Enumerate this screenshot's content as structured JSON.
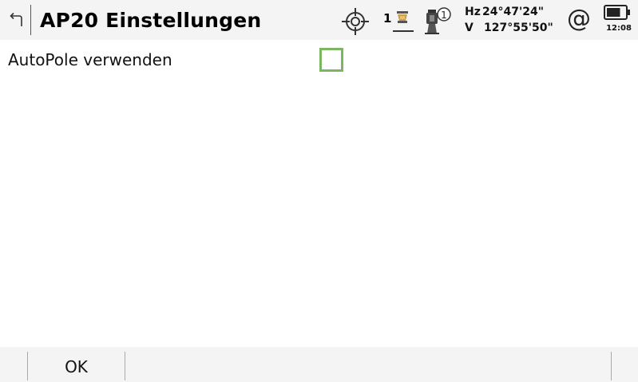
{
  "header": {
    "title": "AP20 Einstellungen",
    "back_icon": "back-arrow-icon",
    "status": {
      "target_icon": "crosshair-target-icon",
      "prism_number": "1",
      "prism_icon": "prism-pole-icon",
      "instrument_icon": "instrument-face-icon",
      "instrument_face": "1",
      "hz_label": "Hz",
      "hz_value": "24°47'24\"",
      "v_label": "V",
      "v_value": "127°55'50\"",
      "connection_symbol": "@",
      "battery_icon": "battery-icon",
      "battery_level": 0.75,
      "time": "12:08"
    }
  },
  "settings": [
    {
      "label": "AutoPole verwenden",
      "checked": false
    }
  ],
  "footer": {
    "softkeys": [
      "OK"
    ]
  },
  "colors": {
    "checkbox_border": "#7bb661",
    "bar_background": "#f4f4f4"
  }
}
